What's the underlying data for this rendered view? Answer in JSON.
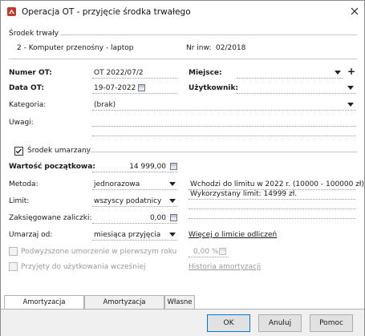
{
  "window": {
    "title": "Operacja OT - przyjęcie środka trwałego",
    "close_icon": "close-icon",
    "app_icon": "app-icon"
  },
  "asset": {
    "section_label": "Środek trwały",
    "name": "2 - Komputer przenośny - laptop",
    "inv_label": "Nr inw:",
    "inv_value": "02/2018"
  },
  "form": {
    "numer_label": "Numer OT:",
    "numer_value": "OT 2022/07/2",
    "miejsce_label": "Miejsce:",
    "miejsce_value": "",
    "data_label": "Data OT:",
    "data_value": "19-07-2022",
    "uzytkownik_label": "Użytkownik:",
    "uzytkownik_value": "",
    "kategoria_label": "Kategoria:",
    "kategoria_value": "(brak)",
    "uwagi_label": "Uwagi:"
  },
  "amortization": {
    "checkbox_label": "Środek umarzany",
    "checked": true,
    "wartosc_label": "Wartość początkowa:",
    "wartosc_value": "14 999,00",
    "metoda_label": "Metoda:",
    "metoda_value": "jednorazowa",
    "limit_label": "Limit:",
    "limit_value": "wszyscy podatnicy",
    "zaksiegowane_label": "Zaksięgowane zaliczki:",
    "zaksiegowane_value": "0,00",
    "umarzaj_label": "Umarzaj od:",
    "umarzaj_value": "miesiąca przyjęcia",
    "info_line1": "Wchodzi do limitu w 2022 r. (10000 - 100000 zł).",
    "info_line2": "Wykorzystany limit: 14999 zł.",
    "limit_link": "Więcej o limicie odliczeń",
    "podwyzszone_label": "Podwyższone umorzenie w pierwszym roku",
    "podwyzszone_pct": "0,00 %",
    "przyjety_label": "Przyjęty do użytkowania wcześniej",
    "historia_link": "Historia amortyzacji"
  },
  "tabs": [
    {
      "label": "Amortyzacja podatkowa",
      "active": true
    },
    {
      "label": "Amortyzacja bilansowa",
      "active": false
    },
    {
      "label": "Własne",
      "active": false
    }
  ],
  "buttons": {
    "ok": "OK",
    "cancel": "Anuluj",
    "help": "Pomoc"
  },
  "colors": {
    "accent": "#0078d7",
    "app_icon": "#c0392b"
  }
}
